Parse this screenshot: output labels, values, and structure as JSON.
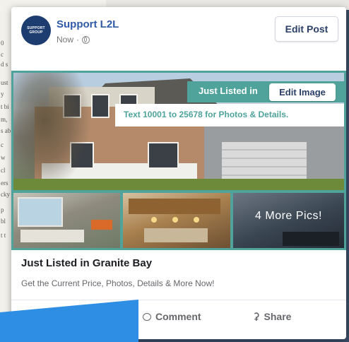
{
  "background_text": [
    "0",
    "c",
    "d s",
    "ust",
    "y",
    "t bi",
    "m,",
    "s ab",
    "c",
    "w",
    "cl",
    "ers",
    "cky",
    "p",
    "bl",
    "t t"
  ],
  "post": {
    "page_name": "Support L2L",
    "avatar_text": [
      "SUPPORT",
      "GROUP"
    ],
    "time": "Now",
    "separator": "·",
    "edit_post_label": "Edit Post"
  },
  "image": {
    "just_listed_label": "Just Listed in",
    "edit_image_label": "Edit Image",
    "text_banner": "Text 10001 to 25678 for Photos & Details.",
    "more_pics_label": "4 More Pics!"
  },
  "link": {
    "headline": "Just Listed in Granite Bay",
    "subline": "Get the Current Price, Photos, Details & More Now!"
  },
  "actions": {
    "comment_label": "Comment",
    "share_label": "Share"
  },
  "colors": {
    "accent_teal": "#4fa39b",
    "page_name_blue": "#2f5aa8",
    "avatar_navy": "#1d3c70",
    "overlay_blue": "#2e8ee3"
  },
  "icons": [
    "globe-icon",
    "comment-icon",
    "share-icon"
  ]
}
